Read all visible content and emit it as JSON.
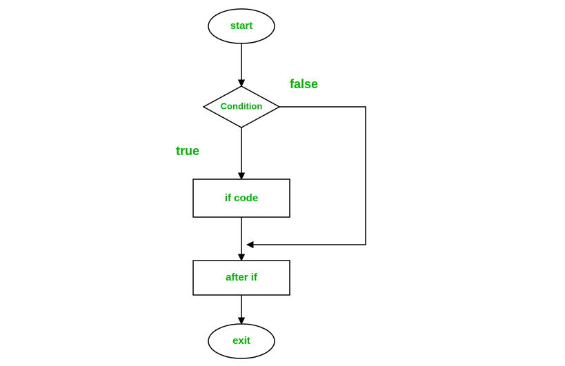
{
  "flowchart": {
    "nodes": {
      "start": {
        "label": "start"
      },
      "condition": {
        "label": "Condition"
      },
      "if_code": {
        "label": "if code"
      },
      "after_if": {
        "label": "after if"
      },
      "exit": {
        "label": "exit"
      }
    },
    "edges": {
      "true_label": "true",
      "false_label": "false"
    }
  },
  "chart_data": {
    "type": "flowchart",
    "nodes": [
      {
        "id": "start",
        "shape": "ellipse",
        "label": "start"
      },
      {
        "id": "condition",
        "shape": "diamond",
        "label": "Condition"
      },
      {
        "id": "if_code",
        "shape": "rectangle",
        "label": "if code"
      },
      {
        "id": "after_if",
        "shape": "rectangle",
        "label": "after if"
      },
      {
        "id": "exit",
        "shape": "ellipse",
        "label": "exit"
      }
    ],
    "edges": [
      {
        "from": "start",
        "to": "condition",
        "label": ""
      },
      {
        "from": "condition",
        "to": "if_code",
        "label": "true"
      },
      {
        "from": "condition",
        "to": "after_if",
        "label": "false",
        "routing": "right-bypass"
      },
      {
        "from": "if_code",
        "to": "after_if",
        "label": ""
      },
      {
        "from": "after_if",
        "to": "exit",
        "label": ""
      }
    ]
  }
}
